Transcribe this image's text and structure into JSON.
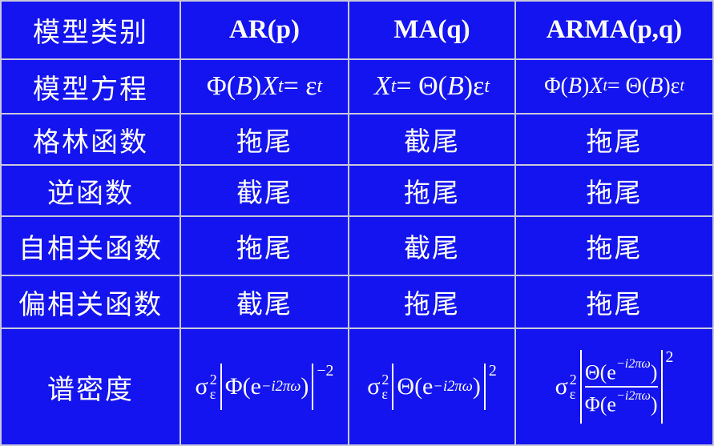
{
  "header": {
    "corner": "模型类别",
    "ar": "AR(p)",
    "ma": "MA(q)",
    "arma": "ARMA(p,q)"
  },
  "rows": [
    {
      "label": "模型方程"
    },
    {
      "label": "格林函数",
      "ar": "拖尾",
      "ma": "截尾",
      "arma": "拖尾"
    },
    {
      "label": "逆函数",
      "ar": "截尾",
      "ma": "拖尾",
      "arma": "拖尾"
    },
    {
      "label": "自相关函数",
      "ar": "拖尾",
      "ma": "截尾",
      "arma": "拖尾"
    },
    {
      "label": "偏相关函数",
      "ar": "截尾",
      "ma": "拖尾",
      "arma": "拖尾"
    },
    {
      "label": "谱密度"
    }
  ],
  "equations": {
    "ar_phi": "Φ(",
    "ar_b": "B",
    "ar_close": ")",
    "ar_x": "X",
    "ar_t": "t",
    "ar_eq": " = ε",
    "ar_t2": "t",
    "ma_x": "X",
    "ma_t": "t",
    "ma_eq": " = Θ(",
    "ma_b": "B",
    "ma_close": ")ε",
    "ma_t2": "t",
    "arma_phi": "Φ(",
    "arma_b": "B",
    "arma_close": ")",
    "arma_x": "X",
    "arma_t": "t",
    "arma_eq": " = Θ(",
    "arma_b2": "B",
    "arma_close2": ")ε",
    "arma_t2": "t"
  },
  "spectral": {
    "sigma": "σ",
    "sq": "2",
    "eps": "ε",
    "ar_func": "Φ(e",
    "ma_func": "Θ(e",
    "exponent": "−i2πω",
    "close": ")",
    "ar_power": "−2",
    "ma_power": "2",
    "arma_num": "Θ(e",
    "arma_den": "Φ(e",
    "arma_power": "2"
  }
}
